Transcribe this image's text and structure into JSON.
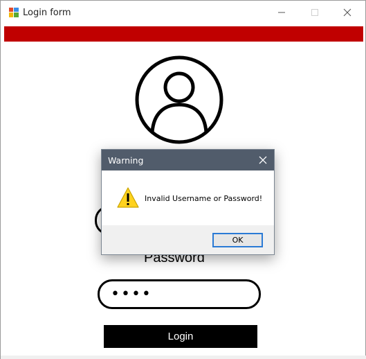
{
  "window": {
    "title": "Login form",
    "accent_bar_color": "#c00000"
  },
  "form": {
    "avatar_icon": "user-circle-icon",
    "password_label": "Password",
    "password_value": "••••",
    "login_label": "Login"
  },
  "dialog": {
    "title": "Warning",
    "icon": "warning-icon",
    "message": "Invalid Username or Password!",
    "ok_label": "OK",
    "titlebar_color": "#515c6b"
  }
}
